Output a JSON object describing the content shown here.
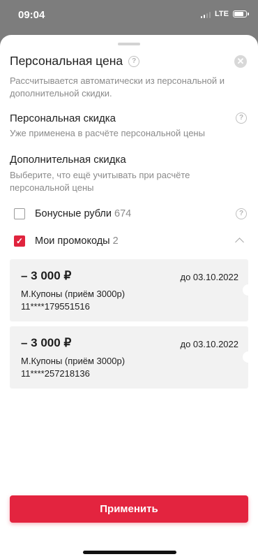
{
  "status_bar": {
    "time": "09:04",
    "network": "LTE"
  },
  "sheet": {
    "title": "Персональная цена",
    "subtitle": "Рассчитывается автоматически из персональной и дополнительной скидки.",
    "personal_discount": {
      "title": "Персональная скидка",
      "description": "Уже применена в расчёте персональной цены"
    },
    "additional_discount": {
      "title": "Дополнительная скидка",
      "description": "Выберите, что ещё учитывать при расчёте персональной цены"
    },
    "options": [
      {
        "label": "Бонусные рубли",
        "count": "674",
        "checked": false
      },
      {
        "label": "Мои промокоды",
        "count": "2",
        "checked": true
      }
    ],
    "coupons": [
      {
        "amount": "– 3 000 ₽",
        "valid_until": "до 03.10.2022",
        "name": "М.Купоны (приём 3000р)",
        "code": "11****179551516"
      },
      {
        "amount": "– 3 000 ₽",
        "valid_until": "до 03.10.2022",
        "name": "М.Купоны (приём 3000р)",
        "code": "11****257218136"
      }
    ],
    "apply_label": "Применить"
  },
  "colors": {
    "accent": "#e3243f",
    "backdrop": "#7d7d7d",
    "card": "#f2f2f2"
  },
  "icons": {
    "help": "question-circle-icon",
    "close": "close-icon",
    "chevron": "chevron-up-icon",
    "check": "checkmark-icon"
  }
}
